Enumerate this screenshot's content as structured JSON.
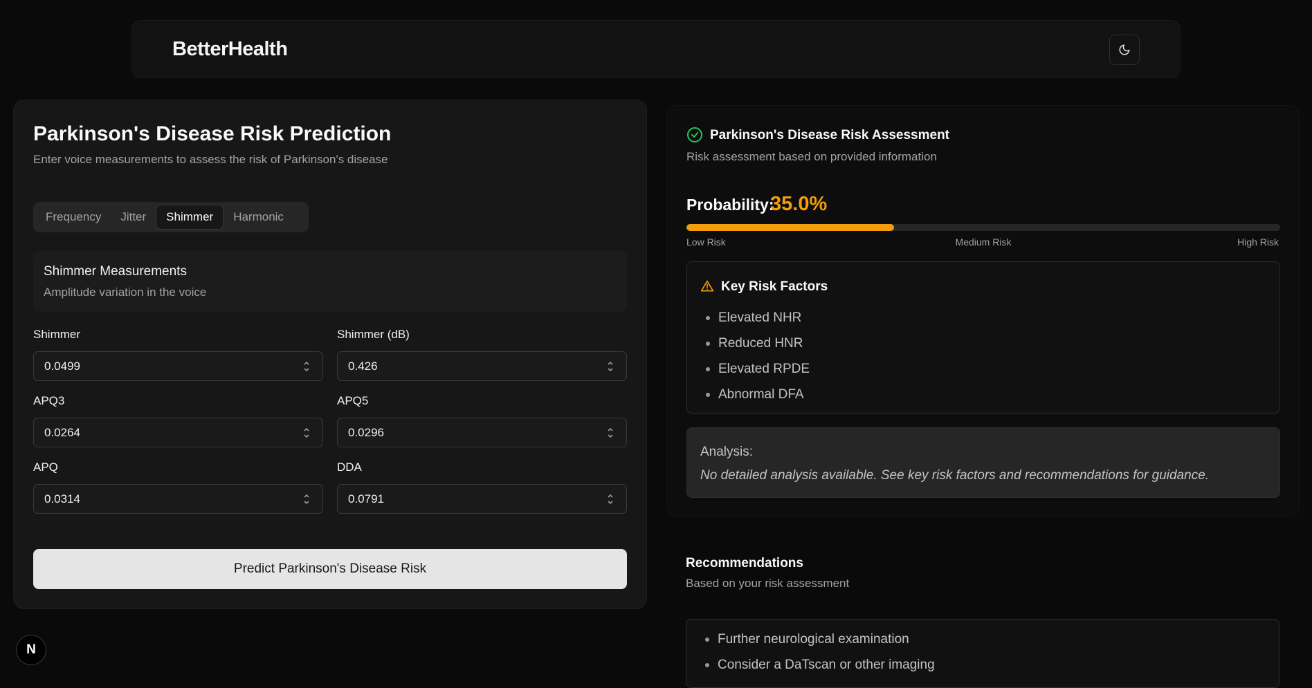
{
  "header": {
    "brand": "BetterHealth",
    "theme_toggle_icon": "moon-icon"
  },
  "form": {
    "title": "Parkinson's Disease Risk Prediction",
    "subtitle": "Enter voice measurements to assess the risk of Parkinson's disease",
    "tabs": [
      {
        "label": "Frequency",
        "active": false
      },
      {
        "label": "Jitter",
        "active": false
      },
      {
        "label": "Shimmer",
        "active": true
      },
      {
        "label": "Harmonic",
        "active": false
      }
    ],
    "section": {
      "title": "Shimmer Measurements",
      "subtitle": "Amplitude variation in the voice"
    },
    "fields": [
      {
        "label": "Shimmer",
        "value": "0.0499"
      },
      {
        "label": "Shimmer (dB)",
        "value": "0.426"
      },
      {
        "label": "APQ3",
        "value": "0.0264"
      },
      {
        "label": "APQ5",
        "value": "0.0296"
      },
      {
        "label": "APQ",
        "value": "0.0314"
      },
      {
        "label": "DDA",
        "value": "0.0791"
      }
    ],
    "predict_label": "Predict Parkinson's Disease Risk"
  },
  "result": {
    "title": "Parkinson's Disease Risk Assessment",
    "subtitle": "Risk assessment based on provided information",
    "probability_label": "Probability:",
    "probability_value": "35.0%",
    "probability_fraction": 0.35,
    "accent_color": "#f59e0b",
    "scale": {
      "low": "Low Risk",
      "medium": "Medium Risk",
      "high": "High Risk"
    },
    "risk_factors_title": "Key Risk Factors",
    "risk_factors": [
      "Elevated NHR",
      "Reduced HNR",
      "Elevated RPDE",
      "Abnormal DFA"
    ],
    "analysis_title": "Analysis:",
    "analysis_text": "No detailed analysis available. See key risk factors and recommendations for guidance."
  },
  "recommendations": {
    "title": "Recommendations",
    "subtitle": "Based on your risk assessment",
    "items": [
      "Further neurological examination",
      "Consider a DaTscan or other imaging"
    ]
  },
  "badge": {
    "letter": "N"
  }
}
